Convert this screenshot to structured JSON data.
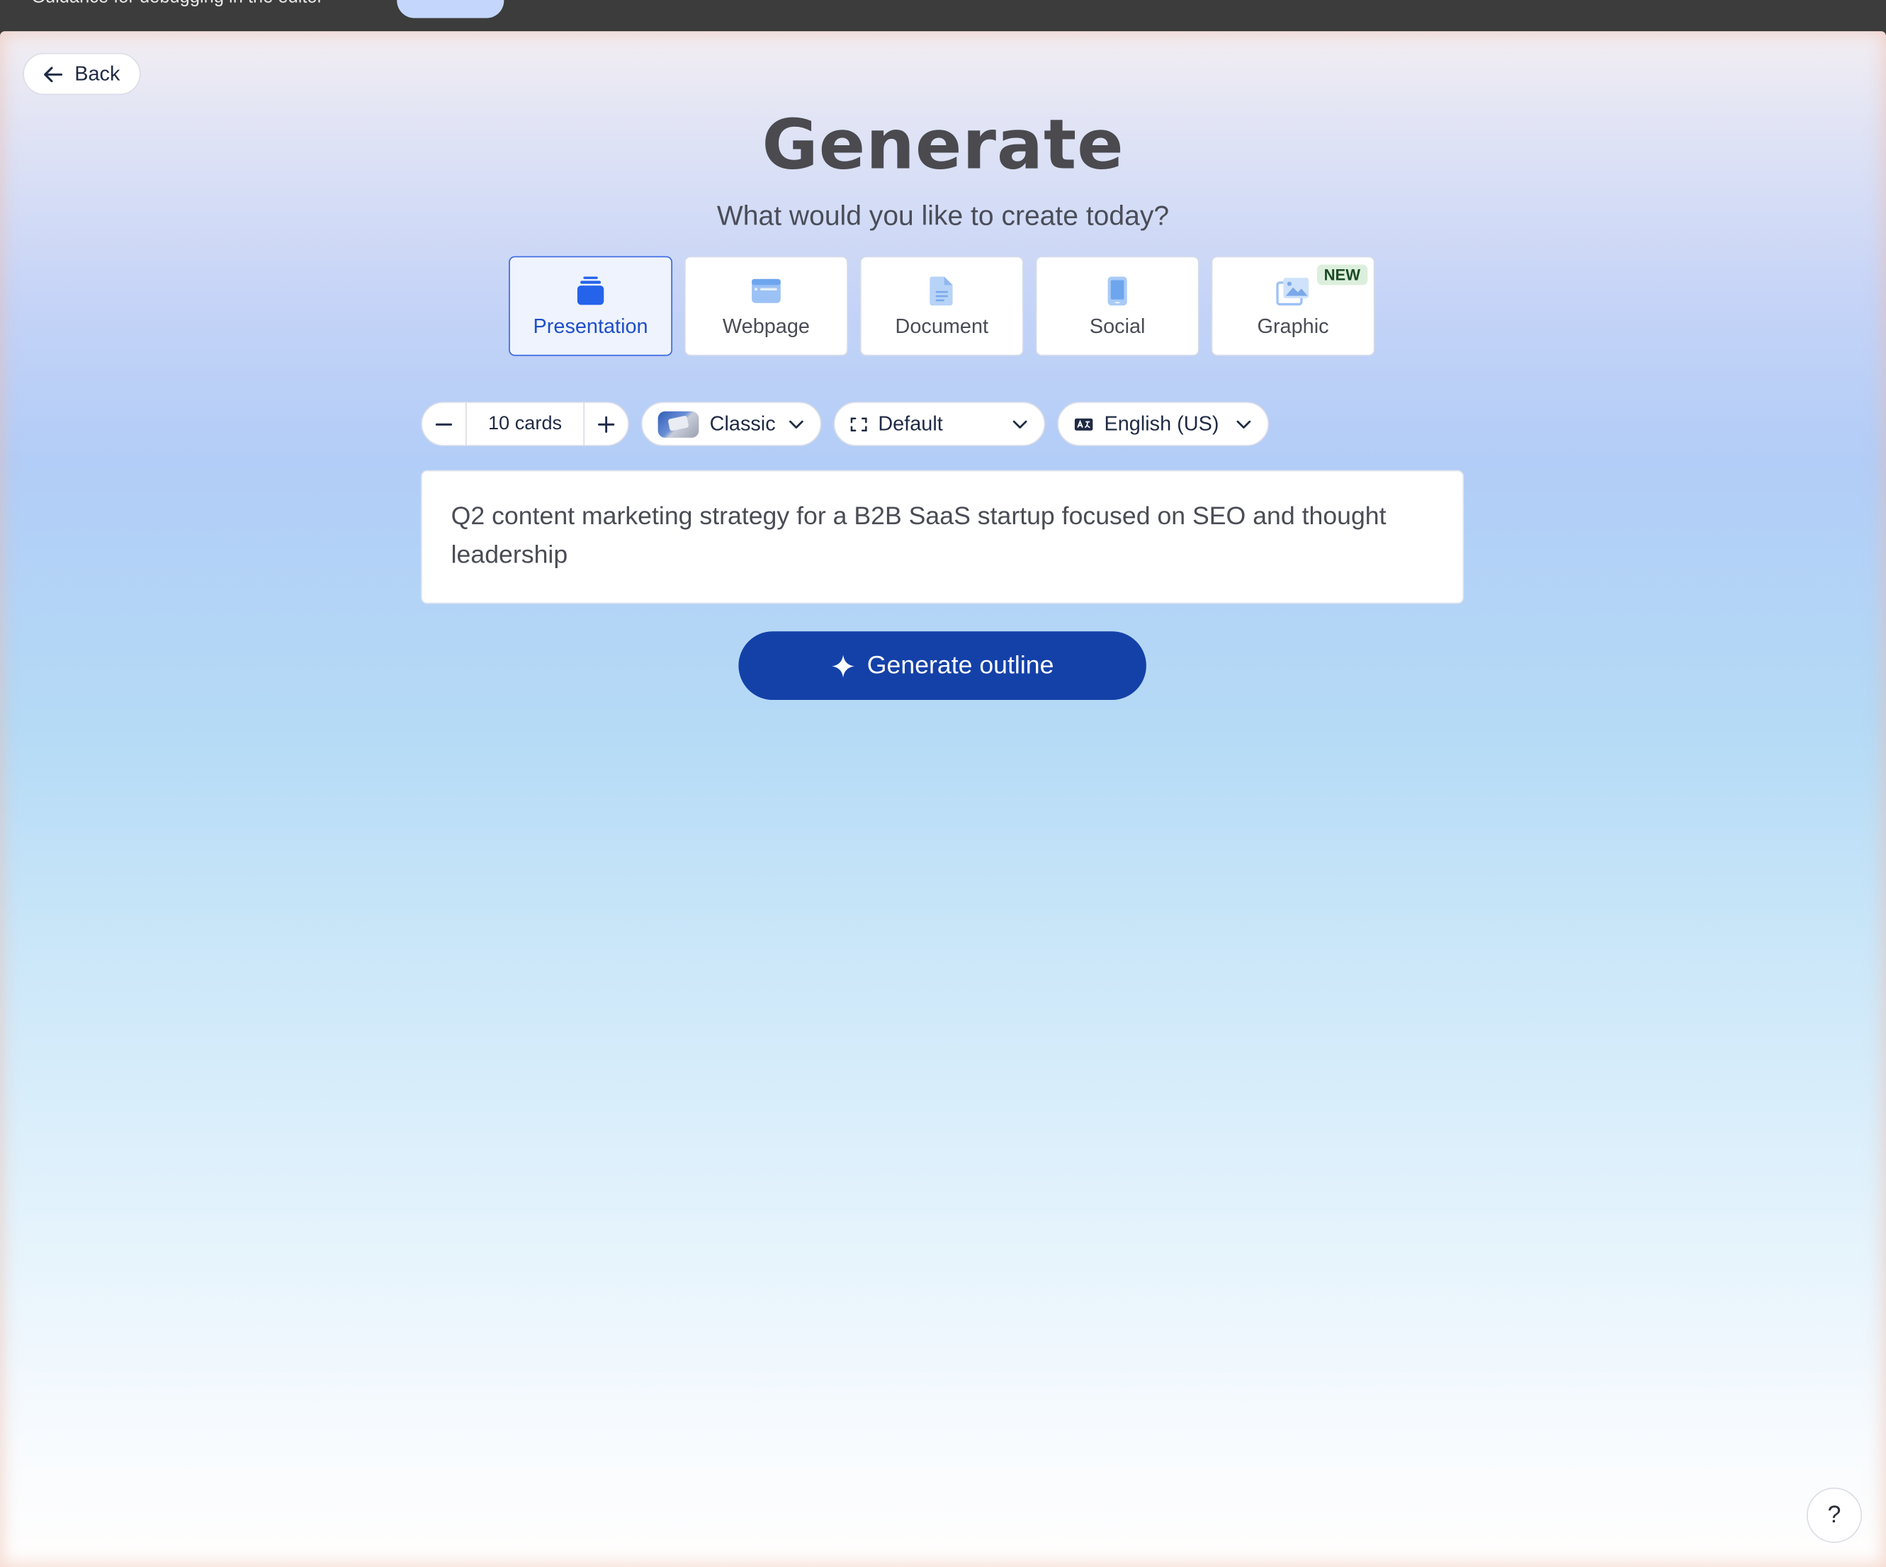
{
  "topbar": {
    "text": "Guidance for debugging in the editor"
  },
  "header": {
    "back_label": "Back",
    "title": "Generate",
    "subtitle": "What would you like to create today?"
  },
  "content_types": [
    {
      "label": "Presentation",
      "icon": "presentation-icon",
      "selected": true
    },
    {
      "label": "Webpage",
      "icon": "webpage-icon",
      "selected": false
    },
    {
      "label": "Document",
      "icon": "document-icon",
      "selected": false
    },
    {
      "label": "Social",
      "icon": "social-icon",
      "selected": false
    },
    {
      "label": "Graphic",
      "icon": "graphic-icon",
      "selected": false,
      "badge": "NEW"
    }
  ],
  "options": {
    "card_count": "10 cards",
    "theme": "Classic",
    "format": "Default",
    "language": "English (US)"
  },
  "prompt": {
    "value": "Q2 content marketing strategy for a B2B SaaS startup focused on SEO and thought leadership"
  },
  "generate_button": {
    "label": "Generate outline"
  },
  "help_button": {
    "label": "?"
  },
  "colors": {
    "accent": "#1441a8",
    "selected_border": "#3a68e0",
    "badge_bg": "#dcefdc"
  }
}
